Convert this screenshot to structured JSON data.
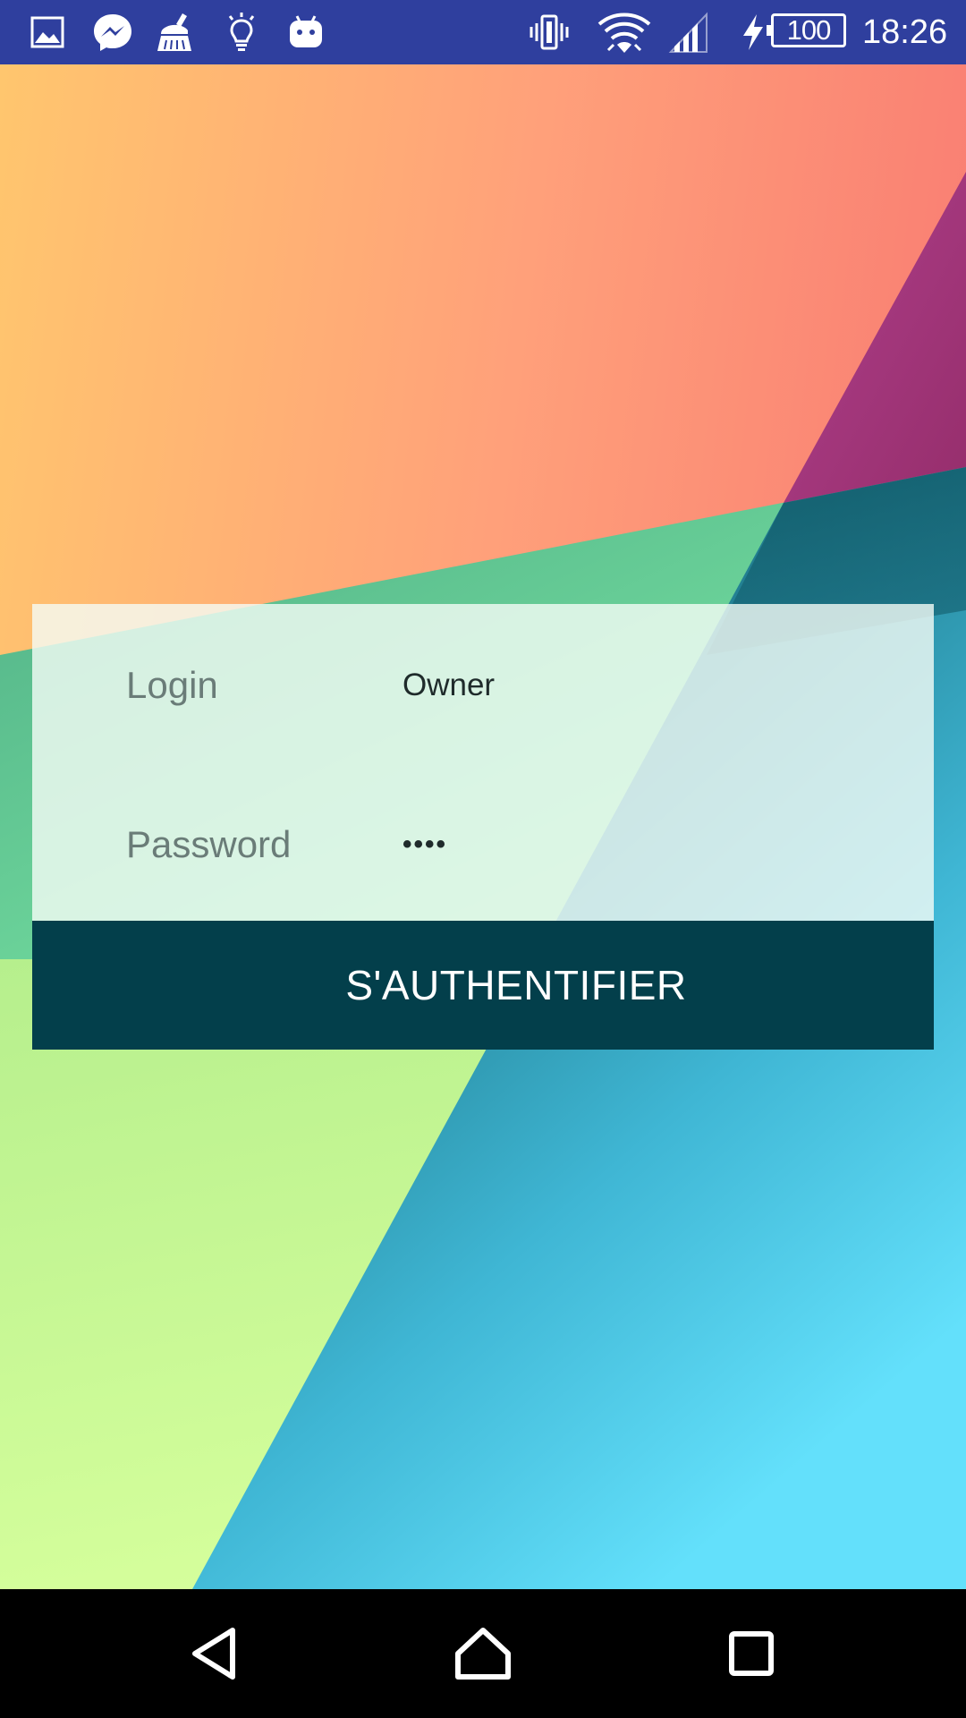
{
  "status_bar": {
    "battery_level": "100",
    "time": "18:26",
    "left_icons": [
      "gallery-icon",
      "messenger-icon",
      "cleaner-icon",
      "lightbulb-icon",
      "android-icon"
    ],
    "right_icons": [
      "vibrate-icon",
      "wifi-icon",
      "signal-icon",
      "charging-icon",
      "battery-icon"
    ]
  },
  "login_form": {
    "login_label": "Login",
    "login_value": "Owner",
    "password_label": "Password",
    "password_value": "••••",
    "submit_label": "S'AUTHENTIFIER"
  },
  "nav_bar": {
    "buttons": [
      "back-icon",
      "home-icon",
      "recents-icon"
    ]
  }
}
